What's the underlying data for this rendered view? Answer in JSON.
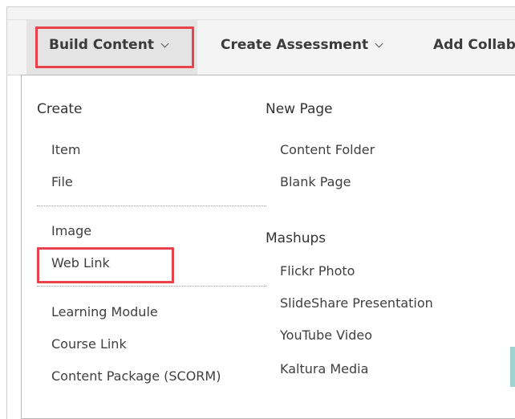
{
  "toolbar": {
    "build_content": "Build Content",
    "create_assessment": "Create Assessment",
    "add_collab": "Add Collab"
  },
  "menu": {
    "create_header": "Create",
    "create_items": [
      "Item",
      "File"
    ],
    "media_items": [
      "Image",
      "Web Link"
    ],
    "other_items": [
      "Learning Module",
      "Course Link",
      "Content Package (SCORM)"
    ],
    "new_page_header": "New Page",
    "new_page_items": [
      "Content Folder",
      "Blank Page"
    ],
    "mashups_header": "Mashups",
    "mashups_items": [
      "Flickr Photo",
      "SlideShare Presentation",
      "YouTube Video",
      "Kaltura Media"
    ]
  },
  "colors": {
    "highlight": "#e8424a",
    "toolbar_bg": "#f4f4f4",
    "active_bg": "#e4e4e4"
  }
}
